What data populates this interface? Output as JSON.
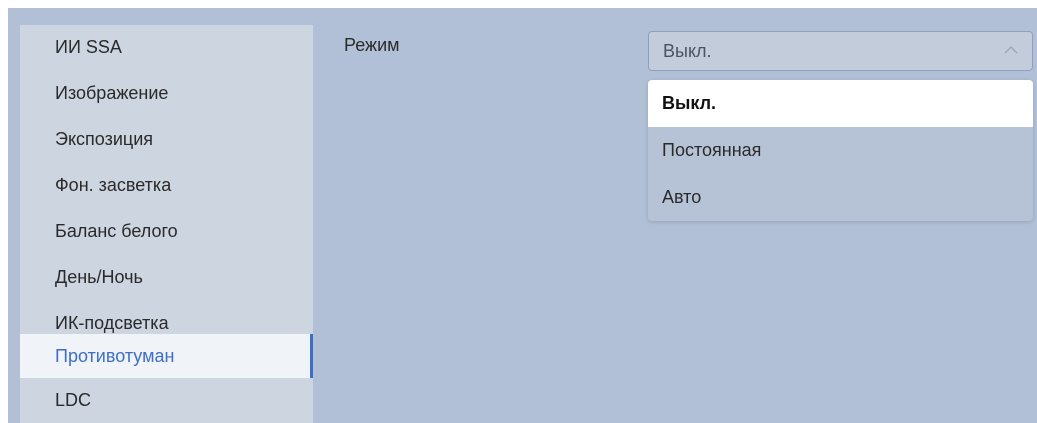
{
  "sidebar": {
    "items": [
      {
        "label": "ИИ SSA"
      },
      {
        "label": "Изображение"
      },
      {
        "label": "Экспозиция"
      },
      {
        "label": "Фон. засветка"
      },
      {
        "label": "Баланс белого"
      },
      {
        "label": "День/Ночь"
      },
      {
        "label": "ИК-подсветка"
      },
      {
        "label": "Противотуман"
      },
      {
        "label": "LDC"
      }
    ],
    "active_item": "Противотуман"
  },
  "form": {
    "mode_label": "Режим",
    "mode_select": {
      "value": "Выкл.",
      "expanded": true,
      "icon": "chevron-up-icon",
      "options": [
        "Выкл.",
        "Постоянная",
        "Авто"
      ]
    }
  },
  "colors": {
    "background": "#b1c0d6",
    "accent": "#3d6fc6"
  }
}
